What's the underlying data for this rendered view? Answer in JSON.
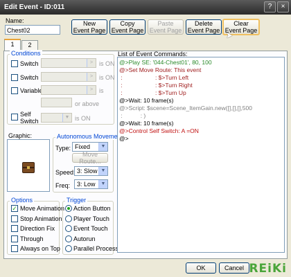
{
  "window": {
    "title": "Edit Event - ID:011",
    "help_icon": "?",
    "close_icon": "×"
  },
  "name_field": {
    "label": "Name:",
    "value": "Chest02"
  },
  "toolbar": {
    "new_page": "New\nEvent Page",
    "copy_page": "Copy\nEvent Page",
    "paste_page": "Paste\nEvent Page",
    "delete_page": "Delete\nEvent Page",
    "clear_page": "Clear\nEvent Page"
  },
  "tabs": [
    {
      "label": "1"
    },
    {
      "label": "2"
    }
  ],
  "conditions": {
    "title": "Conditions",
    "switch1_label": "Switch",
    "switch1_suffix": "is ON",
    "switch2_label": "Switch",
    "switch2_suffix": "is ON",
    "variable_label": "Variable",
    "variable_suffix": "is",
    "or_above": "or above",
    "self_switch_label": "Self\nSwitch",
    "self_switch_suffix": "is ON"
  },
  "graphic": {
    "label": "Graphic:"
  },
  "autonomous": {
    "title": "Autonomous Movement",
    "type_label": "Type:",
    "type_value": "Fixed",
    "move_route_button": "Move Route...",
    "speed_label": "Speed:",
    "speed_value": "3: Slow",
    "freq_label": "Freq:",
    "freq_value": "3: Low"
  },
  "options": {
    "title": "Options",
    "items": [
      {
        "label": "Move Animation",
        "checked": true
      },
      {
        "label": "Stop Animation",
        "checked": false
      },
      {
        "label": "Direction Fix",
        "checked": false
      },
      {
        "label": "Through",
        "checked": false
      },
      {
        "label": "Always on Top",
        "checked": false
      }
    ]
  },
  "trigger": {
    "title": "Trigger",
    "items": [
      {
        "label": "Action Button",
        "selected": true
      },
      {
        "label": "Player Touch",
        "selected": false
      },
      {
        "label": "Event Touch",
        "selected": false
      },
      {
        "label": "Autorun",
        "selected": false
      },
      {
        "label": "Parallel Process",
        "selected": false
      }
    ]
  },
  "commands": {
    "title": "List of Event Commands:",
    "lines": [
      {
        "text": "@>Play SE: '044-Chest01', 80, 100",
        "kind": "play"
      },
      {
        "text": "@>Set Move Route: This event",
        "kind": "move"
      },
      {
        "text": " :                    : $>Turn Left",
        "kind": "move"
      },
      {
        "text": " :                    : $>Turn Right",
        "kind": "move"
      },
      {
        "text": " :                    : $>Turn Up",
        "kind": "move"
      },
      {
        "text": "@>Wait: 10 frame(s)",
        "kind": "normal"
      },
      {
        "text": "@>Script: $scene=Scene_ItemGain.new([],[],[],500",
        "kind": "script"
      },
      {
        "text": " :           : )",
        "kind": "script"
      },
      {
        "text": "@>Wait: 10 frame(s)",
        "kind": "normal"
      },
      {
        "text": "@>Control Self Switch: A =ON",
        "kind": "self"
      },
      {
        "text": "@>",
        "kind": "sel"
      }
    ]
  },
  "footer": {
    "ok": "OK",
    "cancel": "Cancel"
  },
  "watermark": "REiKi"
}
